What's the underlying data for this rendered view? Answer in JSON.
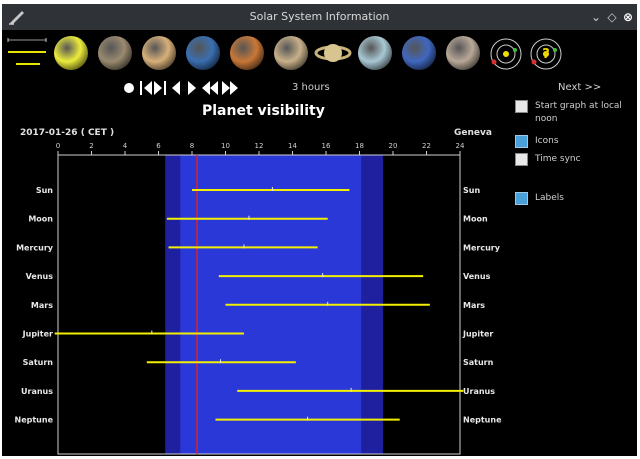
{
  "window": {
    "title": "Solar System Information"
  },
  "planet_icons": [
    {
      "name": "sun",
      "color": "#ecec3c"
    },
    {
      "name": "mercury",
      "color": "#9a8a70"
    },
    {
      "name": "venus",
      "color": "#d8b07a"
    },
    {
      "name": "earth",
      "color": "#3a6fb0"
    },
    {
      "name": "mars",
      "color": "#c87838"
    },
    {
      "name": "jupiter",
      "color": "#c8b08a"
    },
    {
      "name": "saturn",
      "color": "#d8c490"
    },
    {
      "name": "uranus",
      "color": "#a8c8d4"
    },
    {
      "name": "neptune",
      "color": "#4068c0"
    },
    {
      "name": "pluto",
      "color": "#b8a898"
    }
  ],
  "toolbar": {
    "interval_label": "3 hours",
    "next_label": "Next  >>"
  },
  "chart_title": "Planet visibility",
  "date_label": "2017-01-26   ( CET )",
  "location_label": "Geneva",
  "options": {
    "start_noon": {
      "label": "Start graph at local noon",
      "checked": false
    },
    "icons": {
      "label": "Icons",
      "checked": true
    },
    "time_sync": {
      "label": "Time sync",
      "checked": false
    },
    "labels": {
      "label": "Labels",
      "checked": true
    }
  },
  "chart_data": {
    "type": "timeline",
    "x_ticks": [
      0,
      2,
      4,
      6,
      8,
      10,
      12,
      14,
      16,
      18,
      20,
      22,
      24
    ],
    "xlim": [
      0,
      24
    ],
    "night": {
      "dark_end": 6.4,
      "dark_start": 19.4,
      "twilight_start": 7.3,
      "twilight_end": 18.1
    },
    "current_time": 8.3,
    "bodies": [
      {
        "name": "Sun",
        "rise": 8.0,
        "set": 17.4,
        "transit": 12.8
      },
      {
        "name": "Moon",
        "rise": 6.5,
        "set": 16.1,
        "transit": 11.4
      },
      {
        "name": "Mercury",
        "rise": 6.6,
        "set": 15.5,
        "transit": 11.1
      },
      {
        "name": "Venus",
        "rise": 9.6,
        "set": 21.8,
        "transit": 15.8
      },
      {
        "name": "Mars",
        "rise": 10.0,
        "set": 22.2,
        "transit": 16.1
      },
      {
        "name": "Jupiter",
        "rise": -0.2,
        "set": 11.1,
        "transit": 5.6
      },
      {
        "name": "Saturn",
        "rise": 5.3,
        "set": 14.2,
        "transit": 9.7
      },
      {
        "name": "Uranus",
        "rise": 10.7,
        "set": 24.2,
        "transit": 17.5
      },
      {
        "name": "Neptune",
        "rise": 9.4,
        "set": 20.4,
        "transit": 14.9
      }
    ],
    "colors": {
      "bar": "#f2f000",
      "now_line": "#e02020",
      "deep_night": "#1e20a0",
      "twilight": "#2b38d8",
      "day": "#000000"
    }
  }
}
